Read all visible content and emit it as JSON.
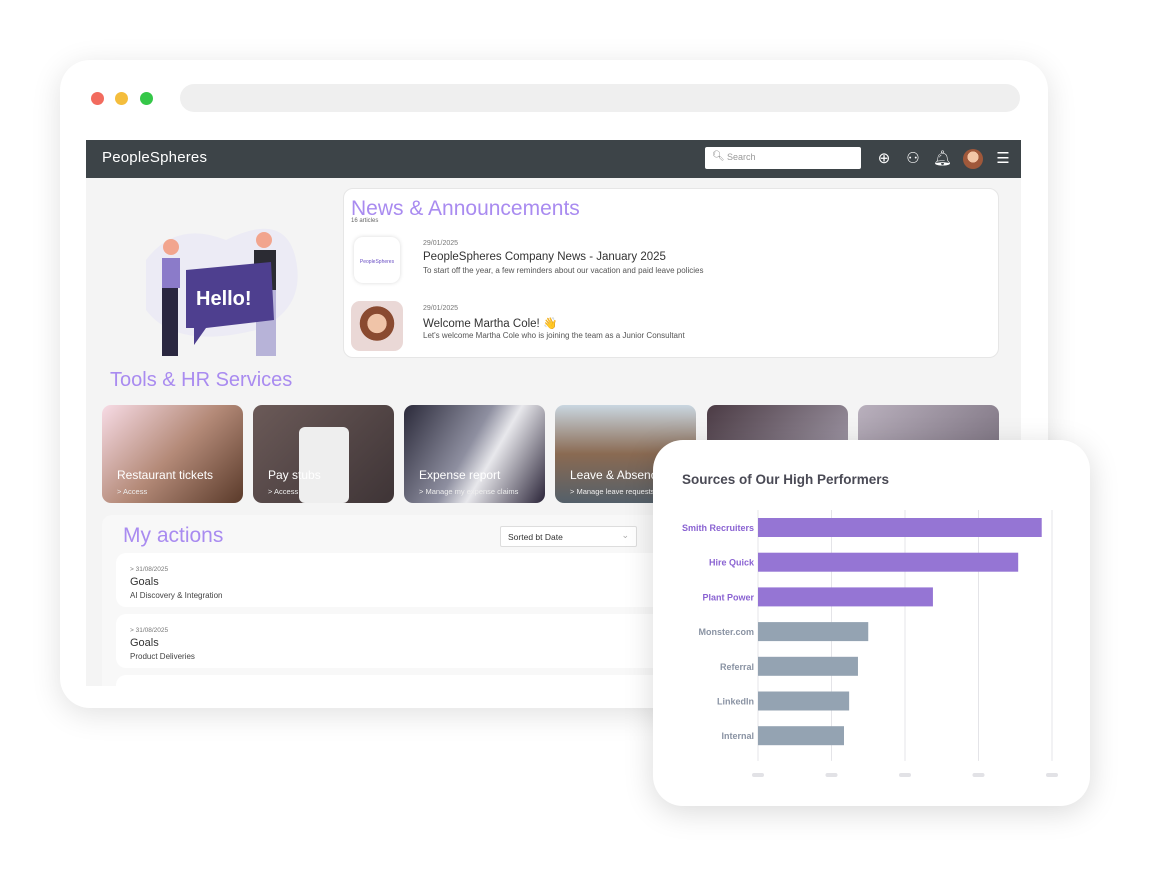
{
  "window": {
    "dots": [
      "#f26b5e",
      "#f4bd3c",
      "#35c748"
    ]
  },
  "header": {
    "logo": "PeopleSpheres",
    "search_placeholder": "Search",
    "icons": [
      "plus-circle-icon",
      "users-icon",
      "bell-icon",
      "avatar",
      "menu-icon"
    ]
  },
  "news": {
    "title": "News & Announcements",
    "count": "16 articles",
    "items": [
      {
        "date": "29/01/2025",
        "title": "PeopleSpheres Company News - January 2025",
        "desc": "To start off the year, a few reminders about our vacation and paid leave policies",
        "thumb_text": "PeopleSpheres"
      },
      {
        "date": "29/01/2025",
        "title": "Welcome Martha Cole! 👋",
        "desc": "Let's welcome Martha Cole who is joining the  team as a Junior Consultant"
      }
    ]
  },
  "illustration": {
    "text": "Hello!"
  },
  "tools": {
    "title": "Tools & HR Services",
    "tiles": [
      {
        "title": "Restaurant tickets",
        "sub": "> Access"
      },
      {
        "title": "Pay stubs",
        "sub": "> Access"
      },
      {
        "title": "Expense report",
        "sub": "> Manage my expense claims"
      },
      {
        "title": "Leave & Absences",
        "sub": "> Manage leave requests"
      },
      {
        "title": "",
        "sub": ""
      },
      {
        "title": "",
        "sub": ""
      }
    ]
  },
  "actions": {
    "title": "My actions",
    "sort": "Sorted bt Date",
    "items": [
      {
        "date": "> 31/08/2025",
        "title": "Goals",
        "sub": "AI Discovery & Integration"
      },
      {
        "date": "> 31/08/2025",
        "title": "Goals",
        "sub": "Product Deliveries"
      }
    ]
  },
  "chart_data": {
    "type": "bar",
    "orientation": "horizontal",
    "title": "Sources of Our High Performers",
    "categories": [
      "Smith Recruiters",
      "Hire Quick",
      "Plant Power",
      "Monster.com",
      "Referral",
      "LinkedIn",
      "Internal"
    ],
    "values": [
      3.86,
      3.54,
      2.38,
      1.5,
      1.36,
      1.24,
      1.17
    ],
    "highlighted": [
      true,
      true,
      true,
      false,
      false,
      false,
      false
    ],
    "colors": {
      "highlight": "#9575d4",
      "normal": "#94a3b2"
    },
    "xlim": [
      0,
      4
    ],
    "grid": true,
    "tick_labels_hidden": true
  }
}
